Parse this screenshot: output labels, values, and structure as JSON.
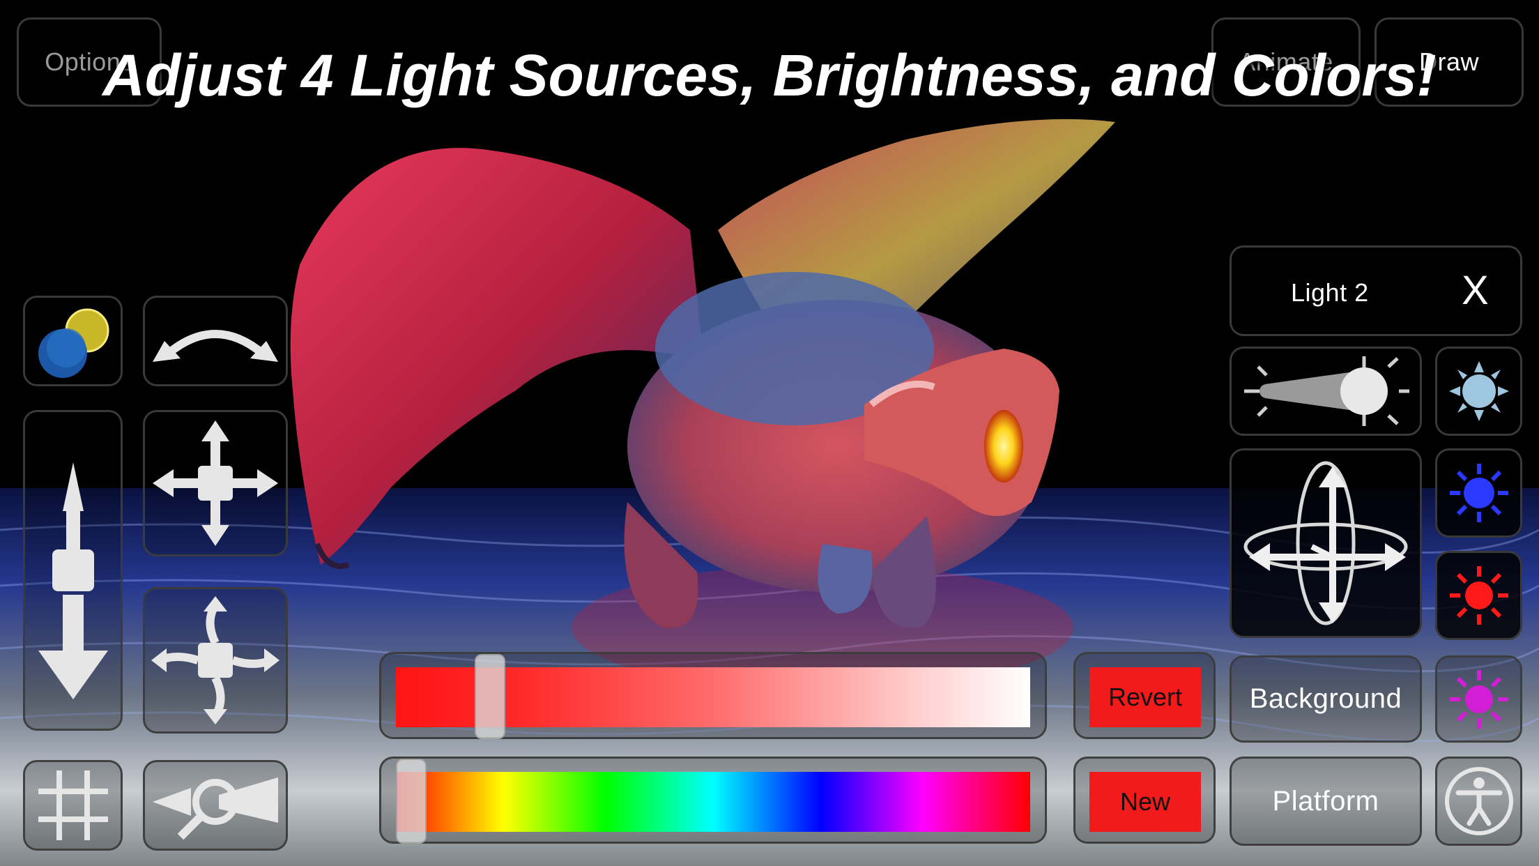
{
  "headline": "Adjust 4 Light Sources, Brightness, and Colors!",
  "top_bar": {
    "options_label": "Options",
    "animate_label": "Animate",
    "draw_label": "Draw"
  },
  "light_panel": {
    "title": "Light 2",
    "close_label": "X"
  },
  "color_sliders": {
    "revert_label": "Revert",
    "new_label": "New",
    "brightness_value": 0.13,
    "hue_value": 0.0
  },
  "scene_buttons": {
    "background_label": "Background",
    "platform_label": "Platform"
  },
  "light_colors": {
    "light_1": "#9fc6df",
    "light_2": "#2b39ff",
    "light_3": "#ff1a1a",
    "light_4": "#d21fd6",
    "selected": "#ff2020"
  },
  "icons": {
    "color_toggle": "color-balls-icon",
    "rotate": "rotate-arc-icon",
    "zoom_move": "camera-dolly-icon",
    "pan": "camera-pan-icon",
    "orbit": "camera-orbit-icon",
    "grid": "grid-icon",
    "magnify": "magnify-icon",
    "brightness": "brightness-slider-icon",
    "light_position": "light-move-icon",
    "accessibility": "accessibility-icon"
  }
}
